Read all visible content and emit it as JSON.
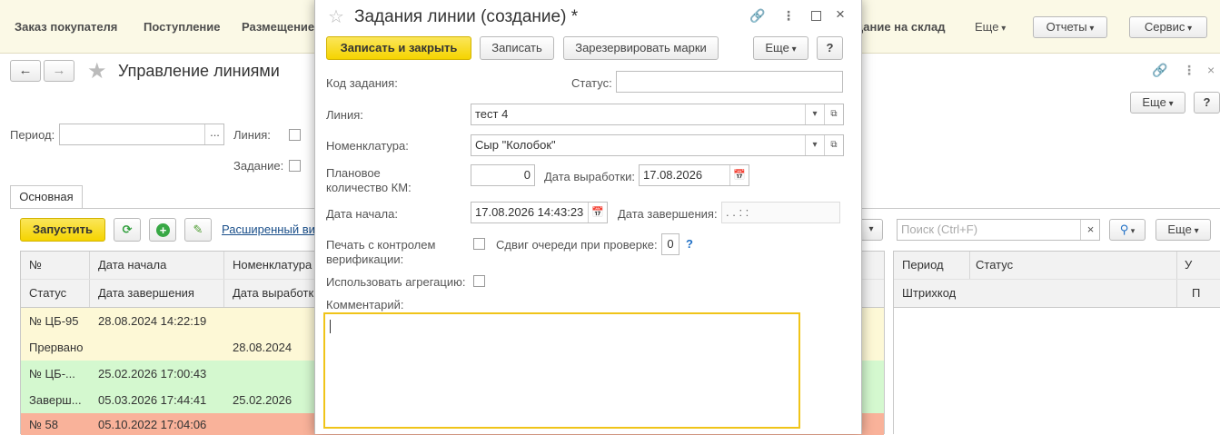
{
  "topbar": {
    "links": [
      "Заказ покупателя",
      "Поступление",
      "Размещение",
      "дание на склад"
    ],
    "more": "Еще",
    "reports": "Отчеты",
    "service": "Сервис"
  },
  "main": {
    "title": "Управление линиями",
    "more": "Еще",
    "help": "?",
    "filters": {
      "period_label": "Период:",
      "period_btn": "...",
      "line_label": "Линия:",
      "task_label": "Задание:"
    },
    "tab": "Основная",
    "toolbar": {
      "start": "Запустить",
      "ext_link": "Расширенный ви"
    },
    "table": {
      "headers1": [
        "№",
        "Дата начала",
        "Номенклатура"
      ],
      "headers2": [
        "Статус",
        "Дата завершения",
        "Дата выработки"
      ],
      "rows": [
        {
          "num": "№ ЦБ-95",
          "start": "28.08.2024 14:22:19",
          "status": "Прервано",
          "end": "",
          "prod": "28.08.2024",
          "color": "#fdf8d6"
        },
        {
          "num": "№ ЦБ-...",
          "start": "25.02.2026 17:00:43",
          "status": "Заверш...",
          "end": "05.03.2026 17:44:41",
          "prod": "25.02.2026",
          "color": "#d4f8cf"
        },
        {
          "num": "№ 58",
          "start": "05.10.2022 17:04:06",
          "status": "",
          "end": "",
          "prod": "",
          "color": "#f9b29a"
        }
      ]
    },
    "right": {
      "search_placeholder": "Поиск (Ctrl+F)",
      "clear": "×",
      "more": "Еще",
      "headers1": [
        "Период",
        "Статус",
        "У"
      ],
      "headers2": [
        "Штрихкод",
        "П"
      ]
    }
  },
  "dialog": {
    "title": "Задания линии (создание) *",
    "buttons": {
      "save_close": "Записать и закрыть",
      "save": "Записать",
      "reserve": "Зарезервировать марки",
      "more": "Еще",
      "help": "?"
    },
    "fields": {
      "code_label": "Код задания:",
      "status_label": "Статус:",
      "status_value": "",
      "line_label": "Линия:",
      "line_value": "тест 4",
      "nom_label": "Номенклатура:",
      "nom_value": "Сыр \"Колобок\"",
      "plan_label_1": "Плановое",
      "plan_label_2": "количество КМ:",
      "plan_value": "0",
      "prod_date_label": "Дата выработки:",
      "prod_date_value": "17.08.2026",
      "start_label": "Дата начала:",
      "start_value": "17.08.2026 14:43:23",
      "end_label": "Дата завершения:",
      "end_value": ".   .       :   :",
      "print_label_1": "Печать с контролем",
      "print_label_2": "верификации:",
      "shift_label": "Сдвиг очереди при проверке:",
      "shift_value": "0",
      "shift_help": "?",
      "aggr_label": "Использовать агрегацию:",
      "comment_label": "Комментарий:",
      "comment_value": ""
    }
  }
}
